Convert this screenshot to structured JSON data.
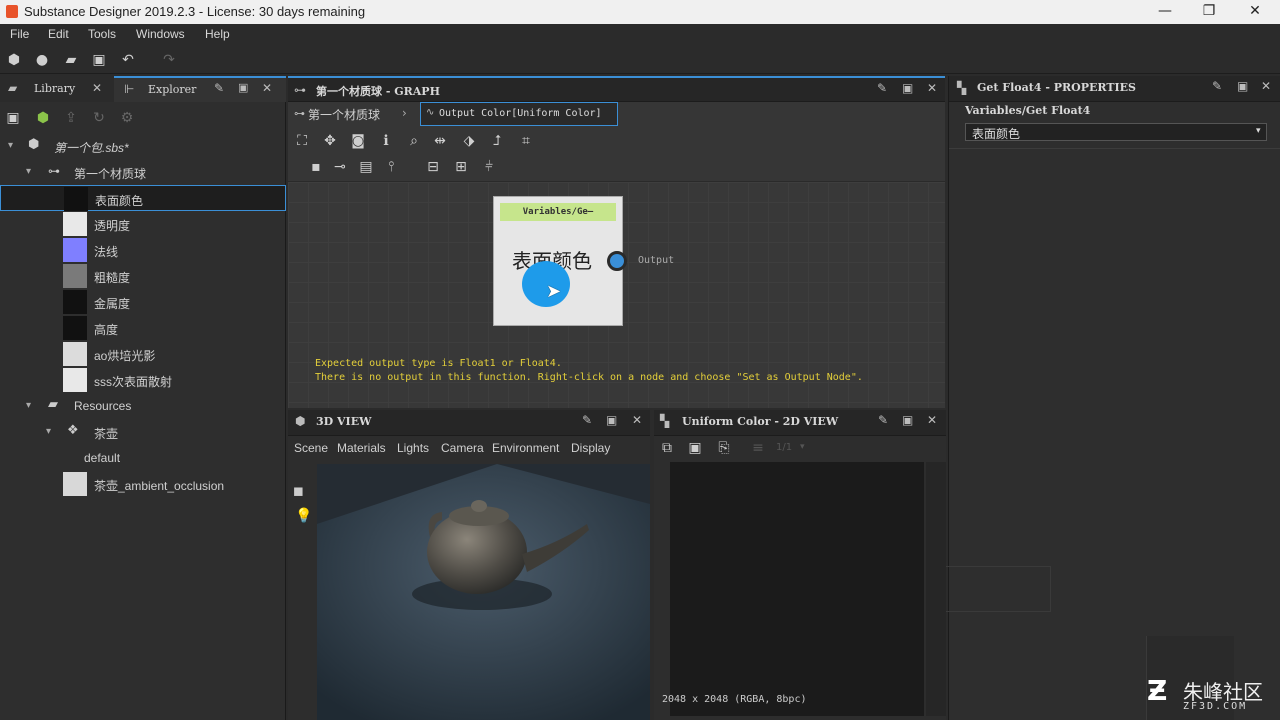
{
  "window": {
    "title": "Substance Designer 2019.2.3 - License: 30 days remaining",
    "minimize": "—",
    "restore": "❐",
    "close": "✕"
  },
  "menu": [
    "File",
    "Edit",
    "Tools",
    "Windows",
    "Help"
  ],
  "left_panel": {
    "tabs": [
      {
        "label": "Library",
        "close": "✕"
      },
      {
        "label": "Explorer"
      }
    ],
    "package": "第一个包.sbs*",
    "graph": "第一个材质球",
    "items": [
      {
        "label": "表面颜色",
        "color": "#111111"
      },
      {
        "label": "透明度",
        "color": "#e8e8e8"
      },
      {
        "label": "法线",
        "color": "#7f7fff"
      },
      {
        "label": "粗糙度",
        "color": "#7a7a7a"
      },
      {
        "label": "金属度",
        "color": "#111111"
      },
      {
        "label": "高度",
        "color": "#111111"
      },
      {
        "label": "ao烘培光影",
        "color": "#dcdcdc"
      },
      {
        "label": "sss次表面散射",
        "color": "#e8e8e8"
      }
    ],
    "resources": "Resources",
    "mesh": "茶壶",
    "mesh_default": "default",
    "ao": "茶壶_ambient_occlusion"
  },
  "graph_panel": {
    "title": "第一个材质球 - GRAPH",
    "breadcrumb_root": "第一个材质球",
    "breadcrumb_current": "Output Color[Uniform Color]",
    "node": {
      "header": "Variables/Ge—",
      "label": "表面颜色",
      "output": "Output",
      "header_color": "#c6e58c"
    },
    "warning_1": "Expected output type is Float1 or Float4.",
    "warning_2": "There is no output in this function. Right-click on a node and choose \"Set as Output Node\"."
  },
  "props_panel": {
    "title": "Get Float4 - PROPERTIES",
    "path": "Variables/Get Float4",
    "select_value": "表面颜色"
  },
  "view3d": {
    "title": "3D VIEW",
    "menu": [
      "Scene",
      "Materials",
      "Lights",
      "Camera",
      "Environment",
      "Display"
    ]
  },
  "view2d": {
    "title": "Uniform Color - 2D VIEW",
    "channel": "1/1",
    "status": "2048 x 2048 (RGBA, 8bpc)"
  },
  "watermark": {
    "brand": "朱峰社区",
    "url": "ZF3D.COM"
  }
}
